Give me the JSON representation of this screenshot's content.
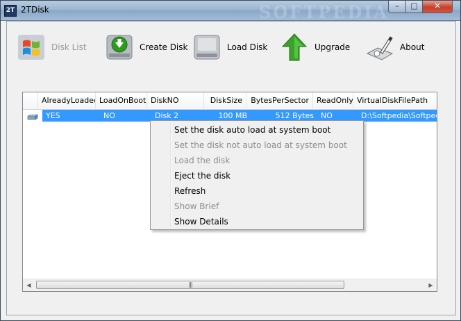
{
  "window": {
    "title": "2TDisk",
    "logo_text": "2T",
    "watermark": "SOFTPEDIA",
    "controls": {
      "minimize": "–",
      "maximize": "□",
      "close": "✕"
    }
  },
  "toolbar": {
    "disk_list": "Disk List",
    "create_disk": "Create Disk",
    "load_disk": "Load Disk",
    "upgrade": "Upgrade",
    "about": "About"
  },
  "table": {
    "columns": [
      "AlreadyLoaded",
      "LoadOnBoot",
      "DiskNO",
      "DiskSize",
      "BytesPerSector",
      "ReadOnly",
      "VirtualDiskFilePath"
    ],
    "rows": [
      [
        "YES",
        "NO",
        "Disk 2",
        "100 MB",
        "512 Bytes",
        "NO",
        "D:\\Softpedia\\Softpedia"
      ]
    ],
    "row_watermark": "SOFTPEDIA"
  },
  "scrollbar": {
    "left_arrow": "◀",
    "right_arrow": "▶",
    "grip": "|||"
  },
  "context_menu": {
    "items": [
      {
        "label": "Set the disk auto load at system boot",
        "enabled": true
      },
      {
        "label": "Set the disk not  auto load at system boot",
        "enabled": false
      },
      {
        "label": "Load the disk",
        "enabled": false
      },
      {
        "label": "Eject the disk",
        "enabled": true
      },
      {
        "label": "Refresh",
        "enabled": true
      },
      {
        "label": "Show Brief",
        "enabled": false
      },
      {
        "label": "Show Details",
        "enabled": true
      }
    ]
  },
  "colors": {
    "selection": "#3399ff",
    "accent_green": "#3aa12a"
  }
}
